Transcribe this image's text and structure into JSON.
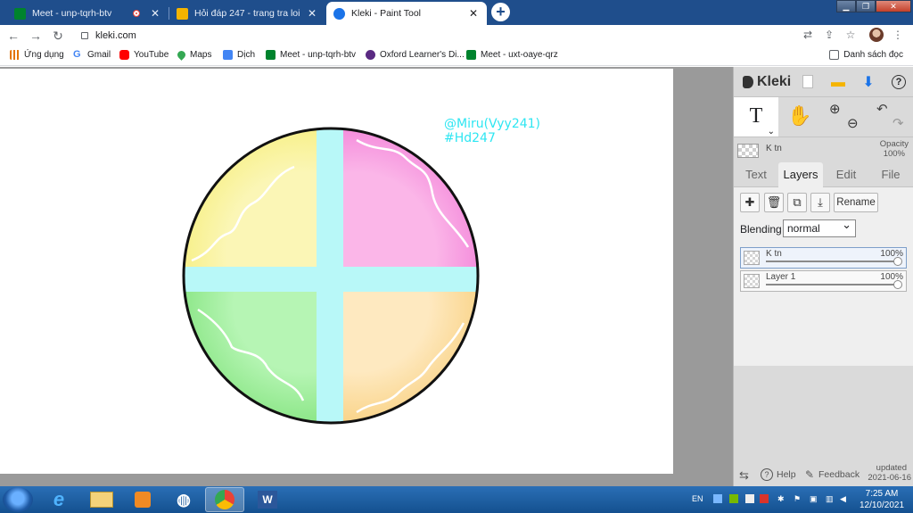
{
  "browser": {
    "tabs": [
      {
        "title": "Meet - unp-tqrh-btv",
        "recording": true,
        "favicon_color": "#00832d"
      },
      {
        "title": "Hỏi đáp 247 - trang tra loi",
        "recording": false,
        "favicon_color": "#f4b400"
      },
      {
        "title": "Kleki - Paint Tool",
        "recording": false,
        "favicon_color": "#1a73e8"
      }
    ],
    "url": "kleki.com",
    "bookmarks": [
      {
        "label": "Ứng dụng",
        "icon": "apps-grid-icon",
        "color": "#e37400"
      },
      {
        "label": "Gmail",
        "icon": "google-g-icon",
        "color": "#4285f4"
      },
      {
        "label": "YouTube",
        "icon": "youtube-icon",
        "color": "#ff0000"
      },
      {
        "label": "Maps",
        "icon": "maps-pin-icon",
        "color": "#34a853"
      },
      {
        "label": "Dịch",
        "icon": "translate-icon",
        "color": "#4285f4"
      },
      {
        "label": "Meet - unp-tqrh-btv",
        "icon": "meet-icon",
        "color": "#00832d"
      },
      {
        "label": "Oxford Learner's Di...",
        "icon": "oxford-icon",
        "color": "#5a2a82"
      },
      {
        "label": "Meet - uxt-oaye-qrz",
        "icon": "meet-icon",
        "color": "#00832d"
      }
    ],
    "reading_list": "Danh sách đọc"
  },
  "canvas": {
    "watermark_line1": "@Miru(Vyy241)",
    "watermark_line2": "#Hd247",
    "watermark_color": "#2ee6f2",
    "quadrant_colors": [
      "#fbf6a8",
      "#fbb3e6",
      "#b4f3b1",
      "#fde7bd"
    ],
    "cross_color": "#b8f8f8"
  },
  "kleki": {
    "brand": "Kleki",
    "active_layer_name": "K tn",
    "opacity_label": "Opacity",
    "opacity_value": "100%",
    "panel_tabs": [
      "Text",
      "Layers",
      "Edit",
      "File"
    ],
    "active_tab": "Layers",
    "rename_label": "Rename",
    "blending_label": "Blending",
    "blending_value": "normal",
    "layers": [
      {
        "name": "K tn",
        "opacity": "100%",
        "selected": true
      },
      {
        "name": "Layer 1",
        "opacity": "100%",
        "selected": false
      }
    ],
    "help_label": "Help",
    "feedback_label": "Feedback",
    "updated_label": "updated",
    "updated_date": "2021-06-16"
  },
  "taskbar": {
    "language": "EN",
    "time": "7:25 AM",
    "date": "12/10/2021"
  }
}
